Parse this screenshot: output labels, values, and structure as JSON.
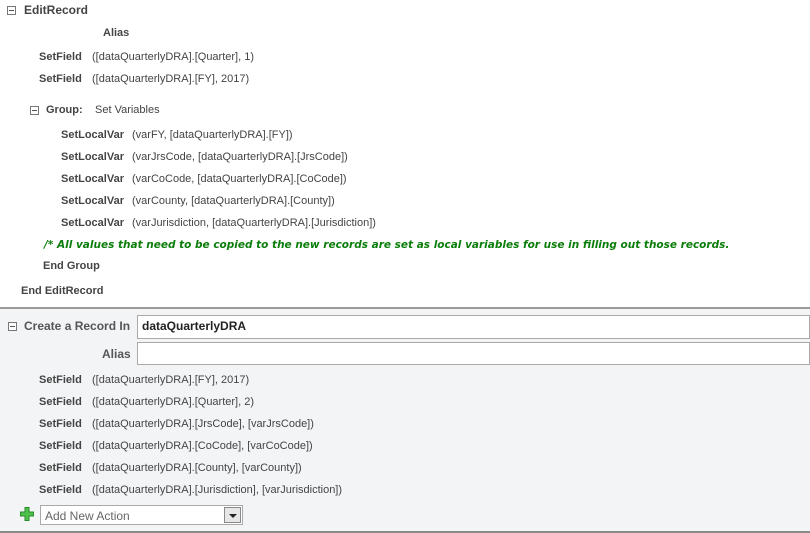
{
  "edit_record": {
    "title": "EditRecord",
    "alias_label": "Alias",
    "actions": [
      {
        "keyword": "SetField",
        "args": "([dataQuarterlyDRA].[Quarter], 1)"
      },
      {
        "keyword": "SetField",
        "args": "([dataQuarterlyDRA].[FY], 2017)"
      }
    ],
    "group": {
      "label": "Group:",
      "name": "Set Variables",
      "actions": [
        {
          "keyword": "SetLocalVar",
          "args": "(varFY, [dataQuarterlyDRA].[FY])"
        },
        {
          "keyword": "SetLocalVar",
          "args": "(varJrsCode, [dataQuarterlyDRA].[JrsCode])"
        },
        {
          "keyword": "SetLocalVar",
          "args": "(varCoCode, [dataQuarterlyDRA].[CoCode])"
        },
        {
          "keyword": "SetLocalVar",
          "args": "(varCounty, [dataQuarterlyDRA].[County])"
        },
        {
          "keyword": "SetLocalVar",
          "args": "(varJurisdiction, [dataQuarterlyDRA].[Jurisdiction])"
        }
      ],
      "comment": "/*    All values that need to be copied to the new records are set as local variables for use in filling out those records.",
      "end_label": "End Group"
    },
    "end_label": "End EditRecord"
  },
  "create_record": {
    "title": "Create a Record In",
    "table_value": "dataQuarterlyDRA",
    "alias_label": "Alias",
    "alias_value": "",
    "actions": [
      {
        "keyword": "SetField",
        "args": "([dataQuarterlyDRA].[FY], 2017)"
      },
      {
        "keyword": "SetField",
        "args": "([dataQuarterlyDRA].[Quarter], 2)"
      },
      {
        "keyword": "SetField",
        "args": "([dataQuarterlyDRA].[JrsCode], [varJrsCode])"
      },
      {
        "keyword": "SetField",
        "args": "([dataQuarterlyDRA].[CoCode], [varCoCode])"
      },
      {
        "keyword": "SetField",
        "args": "([dataQuarterlyDRA].[County], [varCounty])"
      },
      {
        "keyword": "SetField",
        "args": "([dataQuarterlyDRA].[Jurisdiction], [varJurisdiction])"
      }
    ],
    "add_action_placeholder": "Add New Action"
  },
  "colors": {
    "comment": "#0a7d0a",
    "section_bg": "#f3f4f6",
    "plus_icon": "#3cb43c"
  }
}
